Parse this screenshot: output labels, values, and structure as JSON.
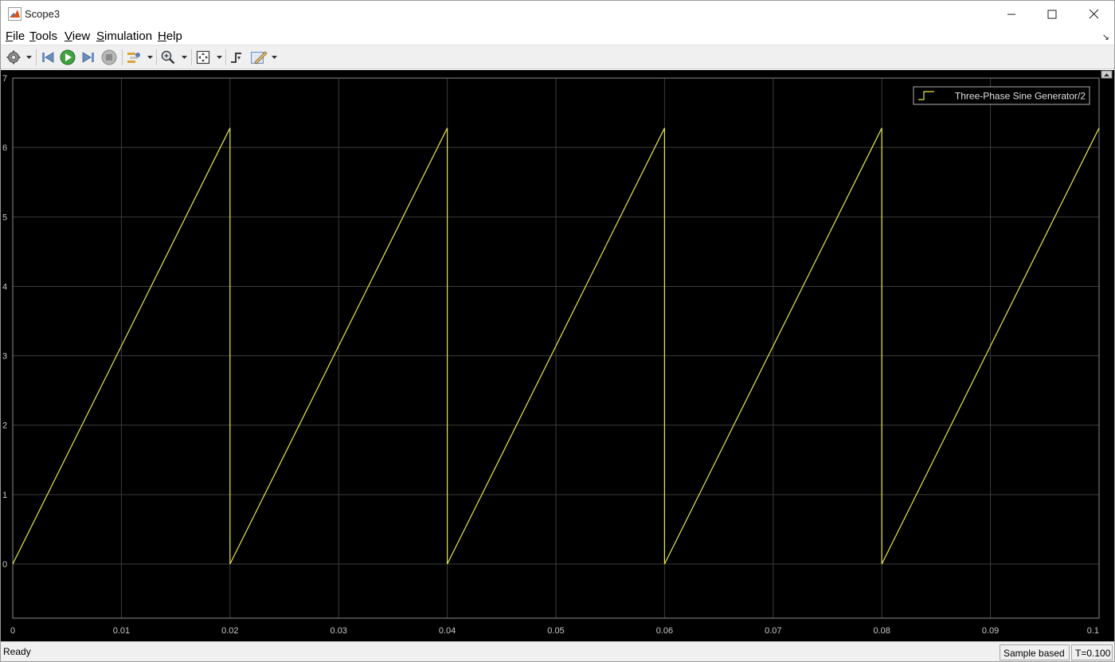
{
  "window": {
    "title": "Scope3"
  },
  "menu": [
    {
      "label": "File",
      "mnemonic": "F",
      "rest": "ile"
    },
    {
      "label": "Tools",
      "mnemonic": "T",
      "rest": "ools"
    },
    {
      "label": "View",
      "mnemonic": "V",
      "rest": "iew"
    },
    {
      "label": "Simulation",
      "mnemonic": "S",
      "rest": "imulation"
    },
    {
      "label": "Help",
      "mnemonic": "H",
      "rest": "elp"
    }
  ],
  "toolbar": {
    "icons": [
      "settings-icon",
      "step-back-icon",
      "run-icon",
      "step-forward-icon",
      "stop-icon",
      "highlight-signal-icon",
      "zoom-icon",
      "autoscale-icon",
      "triggers-icon",
      "style-icon"
    ]
  },
  "status": {
    "text": "Ready",
    "mode": "Sample based",
    "time": "T=0.100"
  },
  "colors": {
    "plot_bg": "#000000",
    "grid": "#3c3c3c",
    "axis_text": "#c8c8c8",
    "signal": "#e8e84a"
  },
  "chart_data": {
    "type": "line",
    "title": "",
    "xlabel": "",
    "ylabel": "",
    "xlim": [
      0,
      0.1
    ],
    "ylim": [
      -0.78,
      7.0
    ],
    "x_ticks": [
      0,
      0.01,
      0.02,
      0.03,
      0.04,
      0.05,
      0.06,
      0.07,
      0.08,
      0.09,
      0.1
    ],
    "x_tick_labels": [
      "0",
      "0.01",
      "0.02",
      "0.03",
      "0.04",
      "0.05",
      "0.06",
      "0.07",
      "0.08",
      "0.09",
      "0.1"
    ],
    "y_ticks": [
      0,
      1,
      2,
      3,
      4,
      5,
      6,
      7
    ],
    "y_tick_labels": [
      "0",
      "1",
      "2",
      "3",
      "4",
      "5",
      "6",
      "7"
    ],
    "grid": true,
    "legend_position": "top-right",
    "series": [
      {
        "name": "Three-Phase Sine Generator/2",
        "color": "#e8e84a",
        "x": [
          0,
          0.02,
          0.02,
          0.04,
          0.04,
          0.06,
          0.06,
          0.08,
          0.08,
          0.1
        ],
        "y": [
          0,
          6.28,
          0,
          6.28,
          0,
          6.28,
          0,
          6.28,
          0,
          6.28
        ]
      }
    ]
  }
}
